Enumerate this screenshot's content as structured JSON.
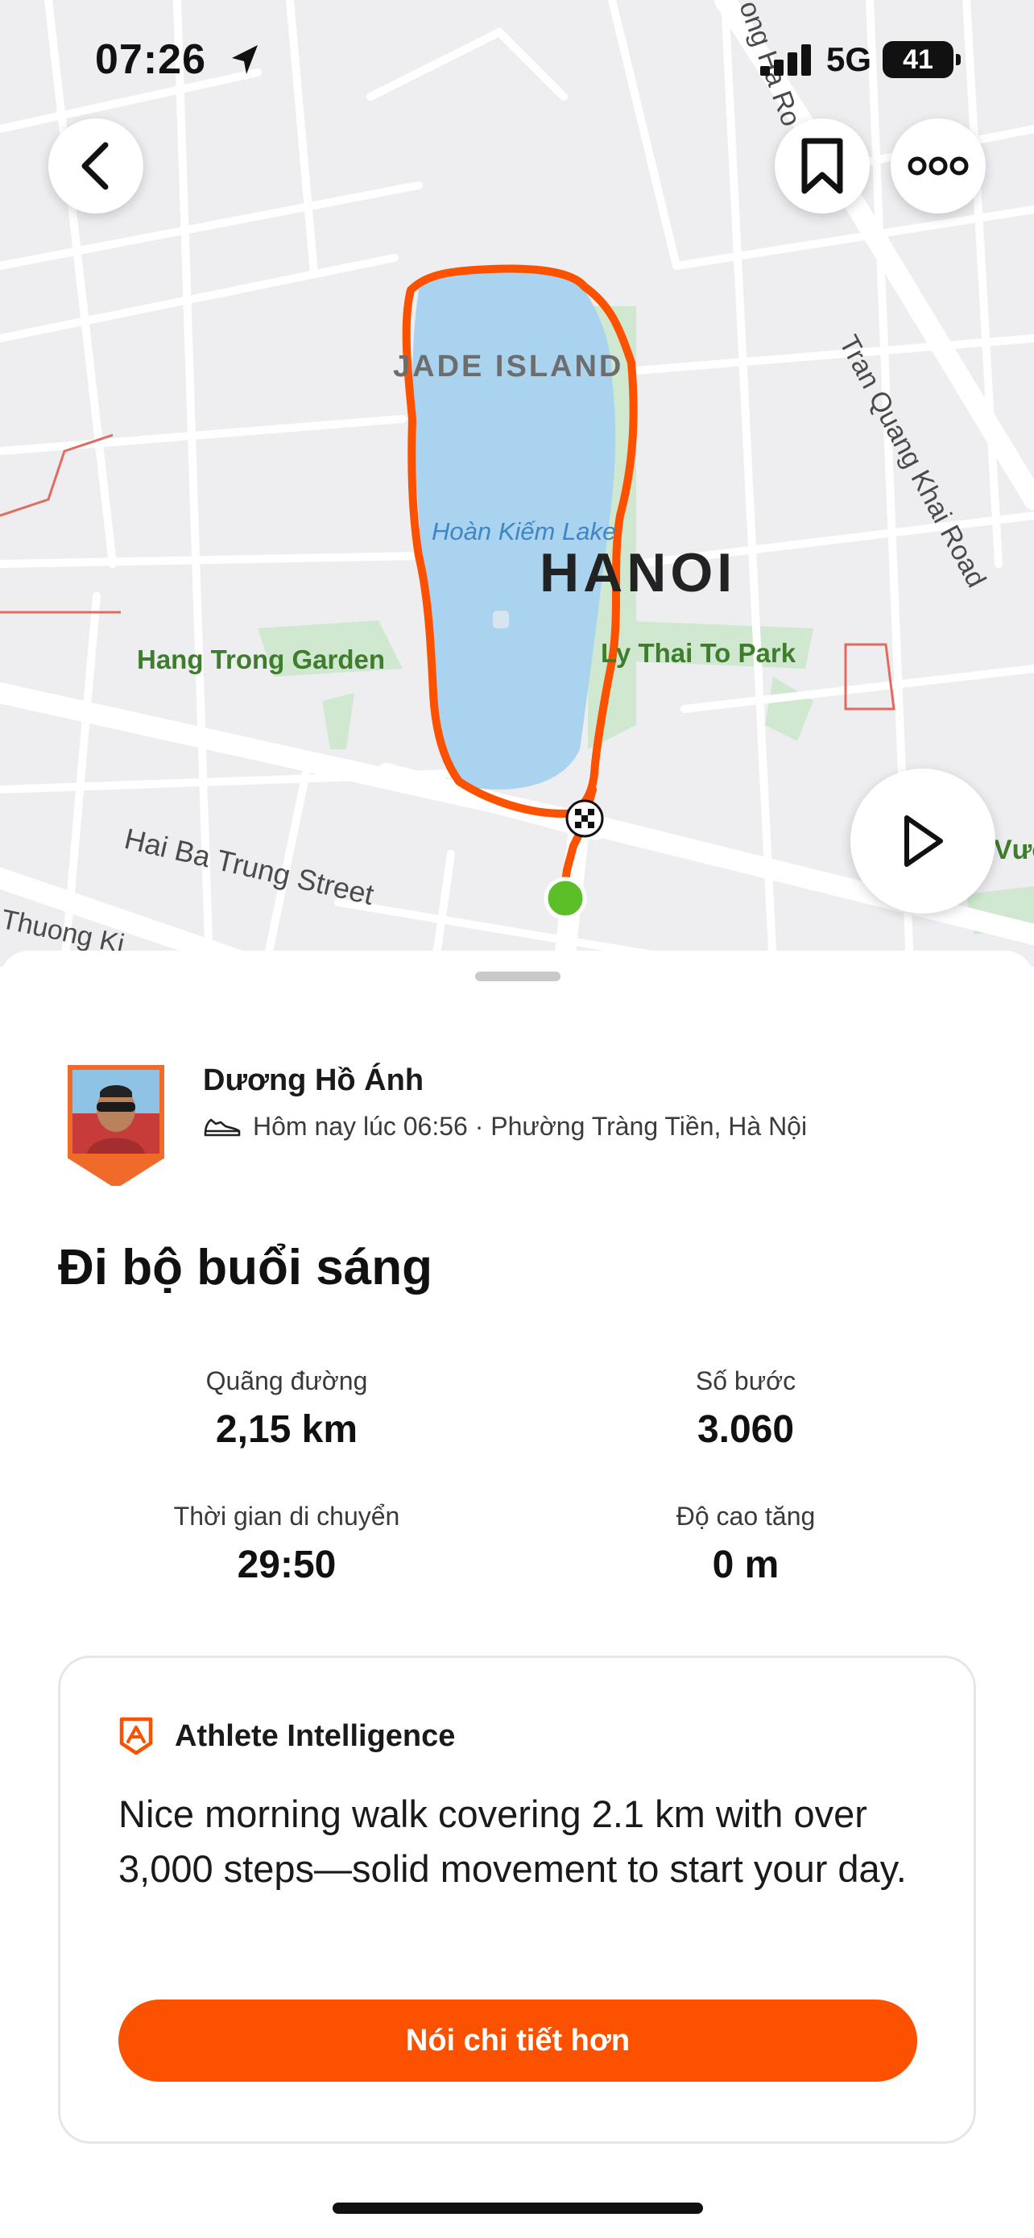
{
  "status_bar": {
    "time": "07:26",
    "network": "5G",
    "battery": "41"
  },
  "map": {
    "labels": {
      "jade_island": "JADE ISLAND",
      "lake": "Hoàn Kiếm Lake",
      "city": "HANOI",
      "garden": "Hang Trong Garden",
      "park": "Ly Thai To Park",
      "street_main": "Hai Ba Trung Street",
      "street_khai": "Tran Quang Khai Road",
      "street_top": "ong Ha Ro",
      "street_thuong": "Thuong Ki",
      "street_edge": "Vườ"
    },
    "route_color": "#fc5200",
    "water_color": "#a9d3ee",
    "park_color": "#cfe8cf"
  },
  "buttons": {
    "back": "back-icon",
    "save": "bookmark-icon",
    "more": "more-icon",
    "play": "play-icon"
  },
  "athlete": {
    "name": "Dương Hồ Ánh",
    "meta": "Hôm nay lúc 06:56 · Phường Tràng Tiền, Hà Nội",
    "activity_icon": "shoe-icon"
  },
  "activity": {
    "title": "Đi bộ buổi sáng",
    "stats": [
      {
        "label": "Quãng đường",
        "value": "2,15 km"
      },
      {
        "label": "Số bước",
        "value": "3.060"
      },
      {
        "label": "Thời gian di chuyển",
        "value": "29:50"
      },
      {
        "label": "Độ cao tăng",
        "value": "0 m"
      }
    ]
  },
  "intelligence": {
    "title": "Athlete Intelligence",
    "body": "Nice morning walk covering 2.1 km with over 3,000 steps—solid movement to start your day.",
    "button_label": "Nói chi tiết hơn",
    "accent": "#fc5200"
  }
}
